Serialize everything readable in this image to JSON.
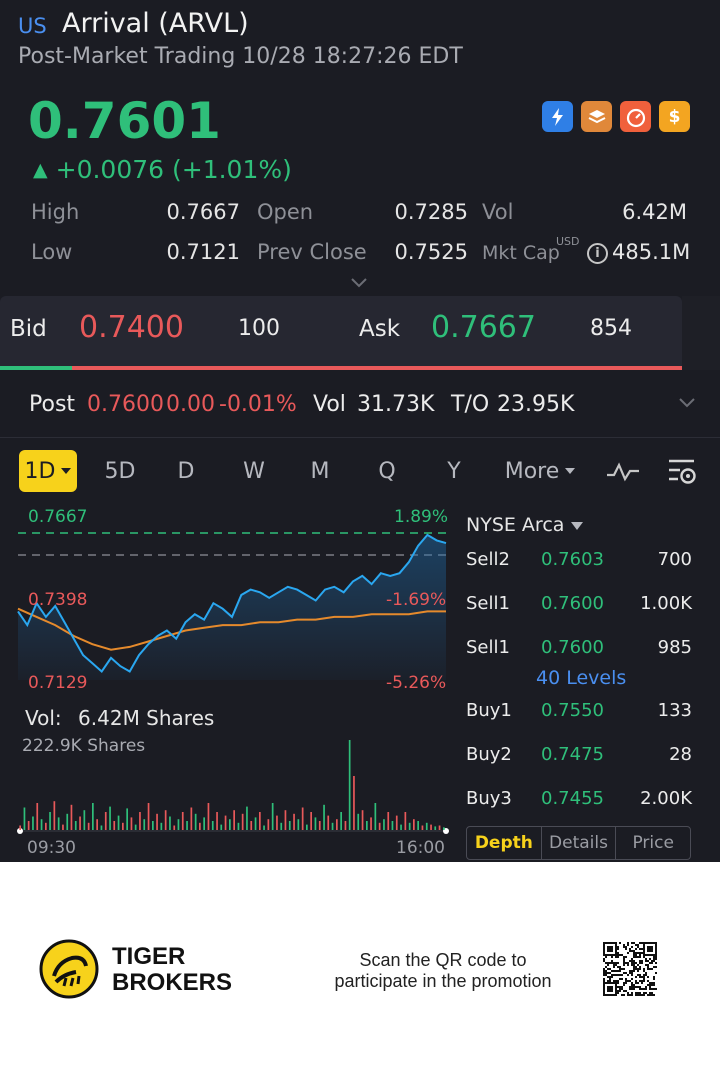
{
  "header": {
    "market": "US",
    "title": "Arrival (ARVL)",
    "subtitle": "Post-Market Trading 10/28 18:27:26 EDT"
  },
  "quote": {
    "price": "0.7601",
    "change": "+0.0076 (+1.01%)",
    "color_up": "#2fbf7a",
    "color_down": "#e8595a"
  },
  "icons": [
    "lightning-icon",
    "layers-icon",
    "speedometer-icon",
    "dollar-icon"
  ],
  "stats": {
    "high_label": "High",
    "high": "0.7667",
    "open_label": "Open",
    "open": "0.7285",
    "vol_label": "Vol",
    "vol": "6.42M",
    "low_label": "Low",
    "low": "0.7121",
    "prev_close_label": "Prev Close",
    "prev_close": "0.7525",
    "mkt_cap_label": "Mkt Cap",
    "mkt_cap_currency": "USD",
    "mkt_cap": "485.1M"
  },
  "bid_ask": {
    "bid_label": "Bid",
    "bid_price": "0.7400",
    "bid_size": "100",
    "ask_label": "Ask",
    "ask_price": "0.7667",
    "ask_size": "854"
  },
  "post": {
    "label": "Post",
    "price": "0.7600",
    "change": "0.00",
    "change_pct": "-0.01%",
    "vol_label": "Vol",
    "vol": "31.73K",
    "turnover_label": "T/O",
    "turnover": "23.95K"
  },
  "tabs": [
    "1D",
    "5D",
    "D",
    "W",
    "M",
    "Q",
    "Y",
    "More"
  ],
  "active_tab": "1D",
  "chart_data": {
    "type": "line",
    "price_high_label": "0.7667",
    "price_high_pct": "1.89%",
    "ref_price_label": "0.7398",
    "ref_pct": "-1.69%",
    "price_low_label": "0.7129",
    "price_low_pct": "-5.26%",
    "x_start": "09:30",
    "x_end": "16:00",
    "ylim": [
      0.7129,
      0.7667
    ],
    "series": [
      {
        "values": [
          0.738,
          0.733,
          0.741,
          0.736,
          0.74,
          0.734,
          0.728,
          0.722,
          0.719,
          0.716,
          0.721,
          0.718,
          0.716,
          0.722,
          0.726,
          0.729,
          0.731,
          0.728,
          0.734,
          0.737,
          0.735,
          0.741,
          0.739,
          0.736,
          0.744,
          0.746,
          0.745,
          0.743,
          0.745,
          0.747,
          0.746,
          0.744,
          0.742,
          0.746,
          0.747,
          0.745,
          0.749,
          0.751,
          0.748,
          0.752,
          0.751,
          0.752,
          0.756,
          0.762,
          0.766,
          0.764,
          0.763
        ]
      },
      {
        "values": [
          0.739,
          0.736,
          0.733,
          0.729,
          0.726,
          0.724,
          0.725,
          0.727,
          0.729,
          0.731,
          0.732,
          0.733,
          0.733,
          0.734,
          0.734,
          0.735,
          0.735,
          0.736,
          0.736,
          0.737,
          0.737,
          0.737,
          0.738,
          0.738
        ]
      }
    ]
  },
  "volume": {
    "title_label": "Vol:",
    "title_value": "6.42M Shares",
    "scale_label": "222.9K Shares",
    "bars": [
      0.05,
      0.25,
      0.1,
      0.15,
      0.3,
      0.12,
      0.08,
      0.2,
      0.32,
      0.14,
      0.06,
      0.18,
      0.28,
      0.1,
      0.15,
      0.22,
      0.08,
      0.3,
      0.12,
      0.05,
      0.2,
      0.26,
      0.1,
      0.16,
      0.08,
      0.24,
      0.14,
      0.06,
      0.2,
      0.12,
      0.3,
      0.1,
      0.18,
      0.08,
      0.22,
      0.15,
      0.05,
      0.12,
      0.2,
      0.1,
      0.25,
      0.18,
      0.08,
      0.14,
      0.3,
      0.1,
      0.2,
      0.06,
      0.16,
      0.12,
      0.22,
      0.08,
      0.18,
      0.26,
      0.1,
      0.14,
      0.2,
      0.05,
      0.12,
      0.3,
      0.16,
      0.08,
      0.22,
      0.1,
      0.18,
      0.12,
      0.25,
      0.06,
      0.2,
      0.14,
      0.1,
      0.28,
      0.16,
      0.08,
      0.12,
      0.2,
      0.1,
      1.0,
      0.6,
      0.18,
      0.22,
      0.1,
      0.14,
      0.3,
      0.08,
      0.12,
      0.2,
      0.1,
      0.16,
      0.06,
      0.2,
      0.08,
      0.12,
      0.1,
      0.05,
      0.08,
      0.06,
      0.04,
      0.05,
      0.03
    ]
  },
  "order_book": {
    "exchange": "NYSE Arca",
    "levels_label": "40 Levels",
    "rows": [
      {
        "label": "Sell2",
        "price": "0.7603",
        "size": "700"
      },
      {
        "label": "Sell1",
        "price": "0.7600",
        "size": "1.00K"
      },
      {
        "label": "Sell1",
        "price": "0.7600",
        "size": "985"
      },
      {
        "label": "Buy1",
        "price": "0.7550",
        "size": "133"
      },
      {
        "label": "Buy2",
        "price": "0.7475",
        "size": "28"
      },
      {
        "label": "Buy3",
        "price": "0.7455",
        "size": "2.00K"
      }
    ],
    "tabs": [
      "Depth",
      "Details",
      "Price"
    ],
    "active_tab": "Depth"
  },
  "footer": {
    "brand_line1": "TIGER",
    "brand_line2": "BROKERS",
    "promo_line1": "Scan the QR code to",
    "promo_line2": "participate in the promotion"
  }
}
